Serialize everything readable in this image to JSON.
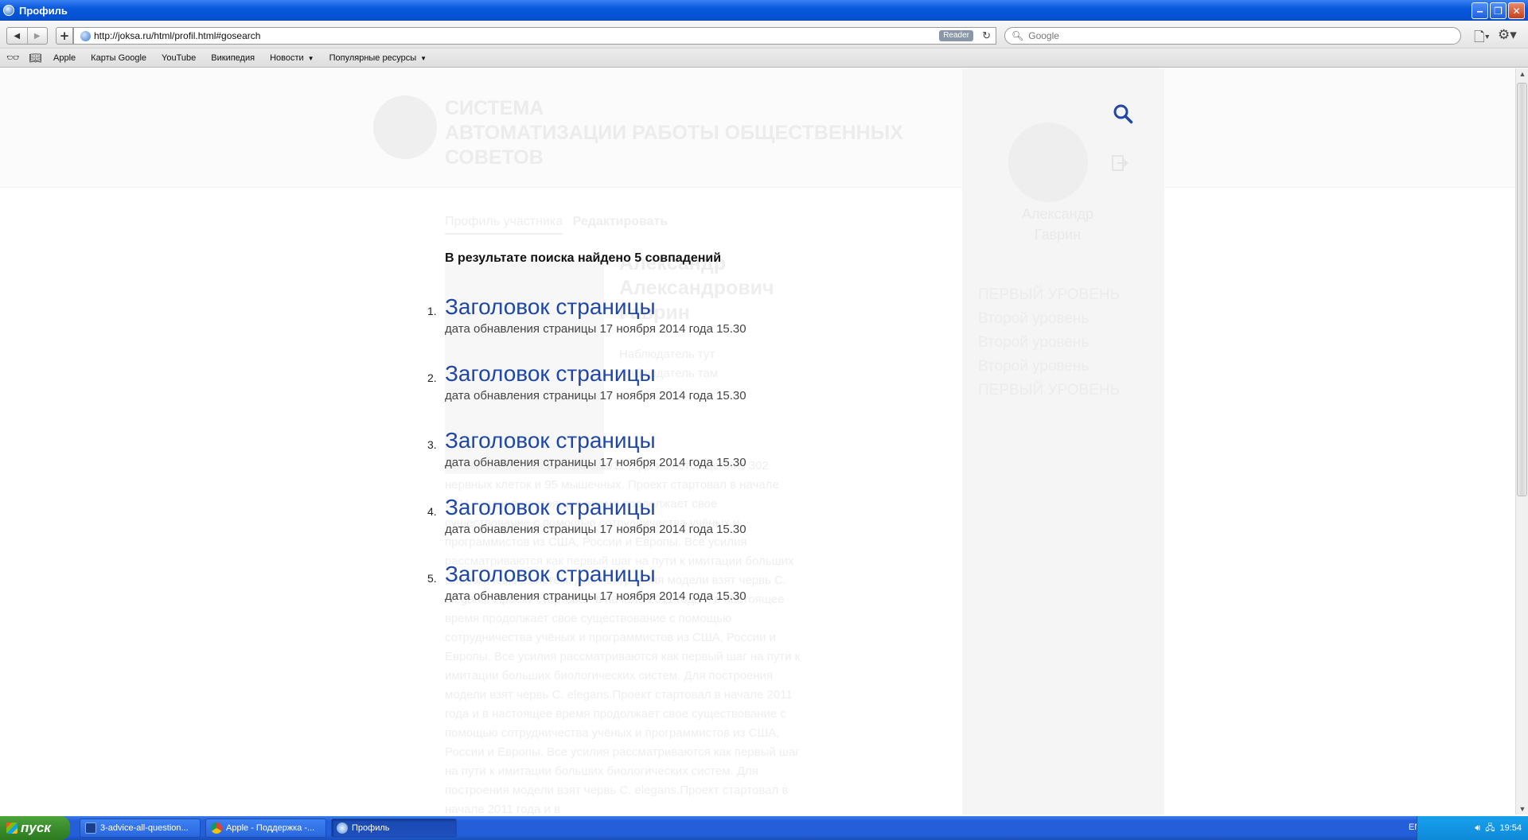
{
  "window": {
    "title": "Профиль"
  },
  "toolbar": {
    "url": "http://joksa.ru/html/profil.html#gosearch",
    "reader_label": "Reader",
    "search_placeholder": "Google"
  },
  "bookmarks": [
    "Apple",
    "Карты Google",
    "YouTube",
    "Википедия",
    "Новости",
    "Популярные ресурсы"
  ],
  "site": {
    "title_lines": [
      "СИСТЕМА",
      "АВТОМАТИЗАЦИИ РАБОТЫ ОБЩЕСТВЕННЫХ",
      "СОВЕТОВ"
    ],
    "tab_profile": "Профиль участника",
    "tab_edit": "Редактировать"
  },
  "search": {
    "summary": "В результате поиска найдено 5 совпадений",
    "results": [
      {
        "num": "1.",
        "title": "Заголовок страницы",
        "date": "дата обнавления страницы 17 ноября 2014 года 15.30"
      },
      {
        "num": "2.",
        "title": "Заголовок страницы",
        "date": "дата обнавления страницы 17 ноября 2014 года 15.30"
      },
      {
        "num": "3.",
        "title": "Заголовок страницы",
        "date": "дата обнавления страницы 17 ноября 2014 года 15.30"
      },
      {
        "num": "4.",
        "title": "Заголовок страницы",
        "date": "дата обнавления страницы 17 ноября 2014 года 15.30"
      },
      {
        "num": "5.",
        "title": "Заголовок страницы",
        "date": "дата обнавления страницы 17 ноября 2014 года 15.30"
      }
    ]
  },
  "profile_ghost": {
    "name_lines": [
      "Александр",
      "Александрович",
      "Гаврин"
    ],
    "role_lines": [
      "Наблюдатель тут",
      "Наблюдатель там"
    ],
    "bio": "Проект стартовал в начале 2011 года и состоящего из 302 нервных клеток и 95 мышечных. Проект стартовал в начале 2011 года и в настоящее время продолжает свое существование с помощью сотрудничества учёных и программистов из США, России и Европы. Все усилия рассматриваются как первый шаг на пути к имитации больших биологических систем. Для построения модели взят червь C. elegans. Проект стартовал в начале 2011 года и в настоящее время продолжает свое существование с помощью сотрудничества учёных и программистов из США, России и Европы. Все усилия рассматриваются как первый шаг на пути к имитации больших биологических систем. Для построения модели взят червь C. elegans.Проект стартовал в начале 2011 года и в настоящее время продолжает свое существование с помощью сотрудничества учёных и программистов из США, России и Европы. Все усилия рассматриваются как первый шаг на пути к имитации больших биологических систем. Для построения модели взят червь C. elegans.Проект стартовал в начале 2011 года и в"
  },
  "sidebar": {
    "user_name_lines": [
      "Александр",
      "Гаврин"
    ],
    "menu": [
      "ПЕРВЫЙ УРОВЕНЬ",
      "Второй уровень",
      "Второй уровень",
      "Второй уровень",
      "ПЕРВЫЙ УРОВЕНЬ"
    ]
  },
  "taskbar": {
    "start_label": "пуск",
    "tasks": [
      "3-advice-all-question...",
      "Apple - Поддержка -...",
      "Профиль"
    ],
    "lang": "EN",
    "clock": "19:54"
  },
  "colors": {
    "link": "#1e47a8",
    "titlebar": "#0a58dc",
    "taskbar": "#245ed9"
  }
}
